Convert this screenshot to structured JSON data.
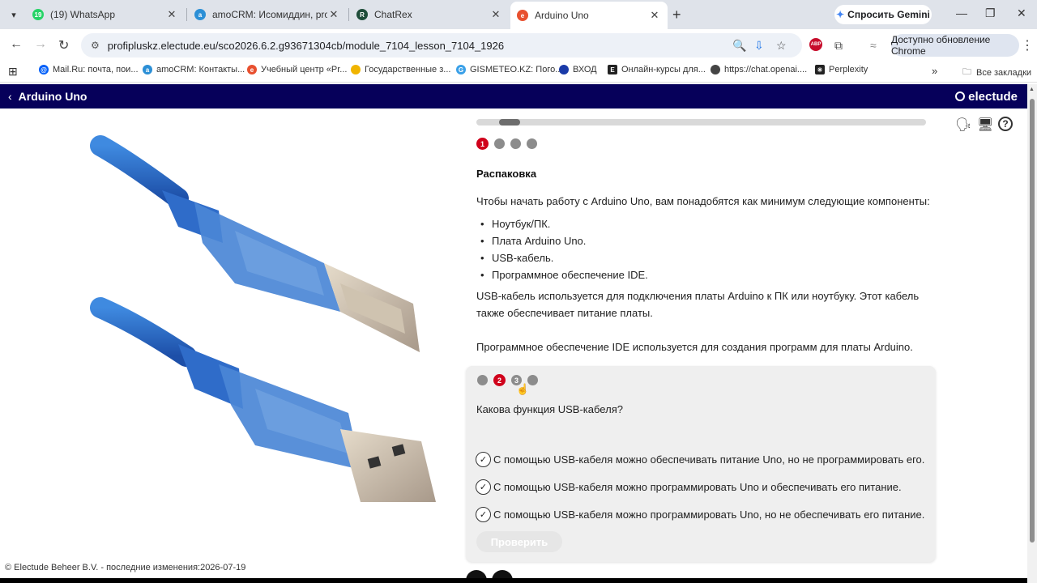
{
  "browser": {
    "tabs": [
      {
        "title": "(19) WhatsApp",
        "badge": "19",
        "color": "#25d366",
        "active": false
      },
      {
        "title": "amoCRM: Исомиддин, profiplu",
        "color": "#2b8fd6",
        "active": false
      },
      {
        "title": "ChatRex",
        "color": "#1f4d3a",
        "active": false
      },
      {
        "title": "Arduino Uno",
        "color": "#e8502f",
        "active": true
      }
    ],
    "gemini_label": "Спросить Gemini",
    "url": "profipluskz.electude.eu/sco2026.6.2.g93671304cb/module_7104_lesson_7104_1926",
    "update_label": "Доступно обновление Chrome",
    "bookmarks": [
      {
        "label": "Mail.Ru: почта, пои...",
        "color": "#005ff9"
      },
      {
        "label": "amoCRM: Контакты...",
        "color": "#2b8fd6"
      },
      {
        "label": "Учебный центр «Pr...",
        "color": "#e8502f"
      },
      {
        "label": "Государственные з...",
        "color": "#f0b400"
      },
      {
        "label": "GISMETEO.KZ: Пого...",
        "color": "#3aa0e8"
      },
      {
        "label": "ВХОД",
        "color": "#1a3aa8"
      },
      {
        "label": "Онлайн-курсы для...",
        "color": "#222222"
      },
      {
        "label": "https://chat.openai....",
        "color": "#444444"
      },
      {
        "label": "Perplexity",
        "color": "#222222"
      }
    ],
    "all_bookmarks": "Все закладки"
  },
  "header": {
    "title": "Arduino Uno",
    "logo": "electude"
  },
  "lesson": {
    "progress_step": 1,
    "steps": [
      "1",
      "",
      "",
      ""
    ],
    "section_title": "Распаковка",
    "intro": "Чтобы начать работу с Arduino Uno, вам понадобятся как минимум следующие компоненты:",
    "items": [
      "Ноутбук/ПК.",
      "Плата Arduino Uno.",
      "USB-кабель.",
      "Программное обеспечение IDE."
    ],
    "para1": "USB-кабель используется для подключения платы Arduino к ПК или ноутбуку. Этот кабель также обеспечивает питание платы.",
    "para2": "Программное обеспечение IDE используется для создания программ для платы Arduino."
  },
  "quiz": {
    "steps": [
      "",
      "2",
      "3",
      ""
    ],
    "question": "Какова функция USB-кабеля?",
    "options": [
      "С помощью USB-кабеля можно обеспечивать питание Uno, но не программировать его.",
      "С помощью USB-кабеля можно программировать Uno и обеспечивать его питание.",
      "С помощью USB-кабеля можно программировать Uno, но не обеспечивать его питание."
    ],
    "check_label": "Проверить"
  },
  "footer": {
    "text": "© Electude Beheer B.V. - последние изменения:2026-07-19"
  },
  "colors": {
    "header_bg": "#06005a",
    "accent_red": "#d0021b",
    "cable_blue": "#1f5fc4"
  }
}
